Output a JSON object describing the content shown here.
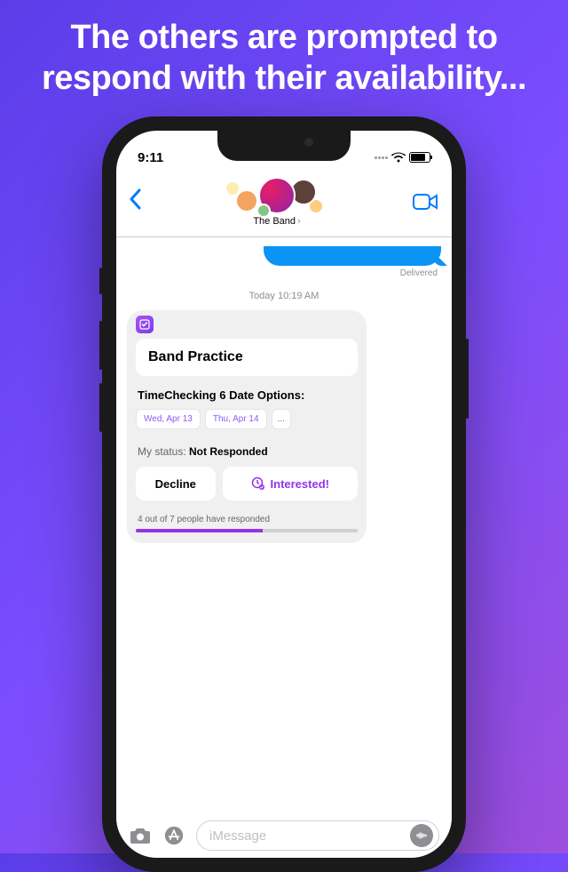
{
  "headline": "The others are prompted to respond with their availability...",
  "statusBar": {
    "time": "9:11"
  },
  "nav": {
    "chatName": "The Band",
    "chevron": "›"
  },
  "chat": {
    "deliveredLabel": "Delivered",
    "timestamp": "Today 10:19 AM"
  },
  "card": {
    "eventTitle": "Band Practice",
    "timecheckLabel": "TimeChecking 6 Date Options:",
    "dateOptions": [
      "Wed, Apr 13",
      "Thu, Apr 14"
    ],
    "moreLabel": "...",
    "myStatusLabel": "My status: ",
    "myStatusValue": "Not Responded",
    "declineLabel": "Decline",
    "interestedLabel": "Interested!",
    "responseCount": "4 out of 7 people have responded",
    "progressPercent": 57
  },
  "input": {
    "placeholder": "iMessage"
  }
}
